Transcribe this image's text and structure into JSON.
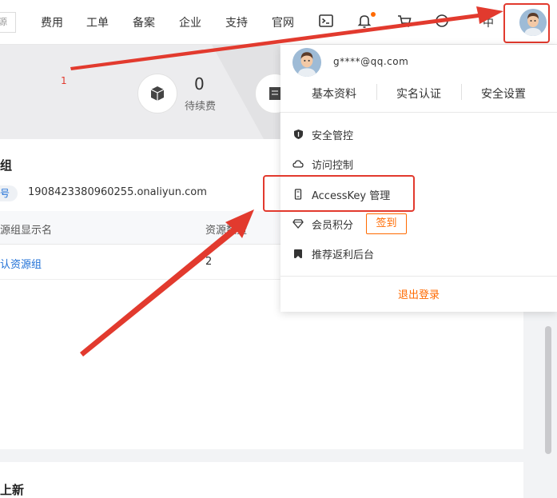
{
  "nav": {
    "search_stub": "源",
    "items": [
      "费用",
      "工单",
      "备案",
      "企业",
      "支持",
      "官网"
    ],
    "partial_item": "中"
  },
  "banner": {
    "stat_value": "0",
    "stat_label": "待续费"
  },
  "resource_group": {
    "title": "组",
    "tag_label": "号",
    "account_id": "1908423380960255.onaliyun.com",
    "columns": [
      "源组显示名",
      "资源数量"
    ],
    "rows": [
      {
        "name": "认资源组",
        "count": "2"
      }
    ]
  },
  "section2": {
    "title": "上新"
  },
  "dropdown": {
    "email": "g****@qq.com",
    "quick_links": [
      "基本资料",
      "实名认证",
      "安全设置"
    ],
    "menu": [
      {
        "label": "安全管控",
        "icon": "shield-icon"
      },
      {
        "label": "访问控制",
        "icon": "cloud-icon"
      },
      {
        "label": "AccessKey 管理",
        "icon": "key-icon"
      },
      {
        "label": "会员积分",
        "icon": "diamond-icon",
        "action": "签到"
      },
      {
        "label": "推荐返利后台",
        "icon": "bookmark-icon"
      }
    ],
    "logout": "退出登录"
  },
  "annotation": {
    "step_number": "1"
  },
  "colors": {
    "accent": "#ff6a00",
    "link": "#1d6fd6",
    "annotation_red": "#e23a2e"
  }
}
